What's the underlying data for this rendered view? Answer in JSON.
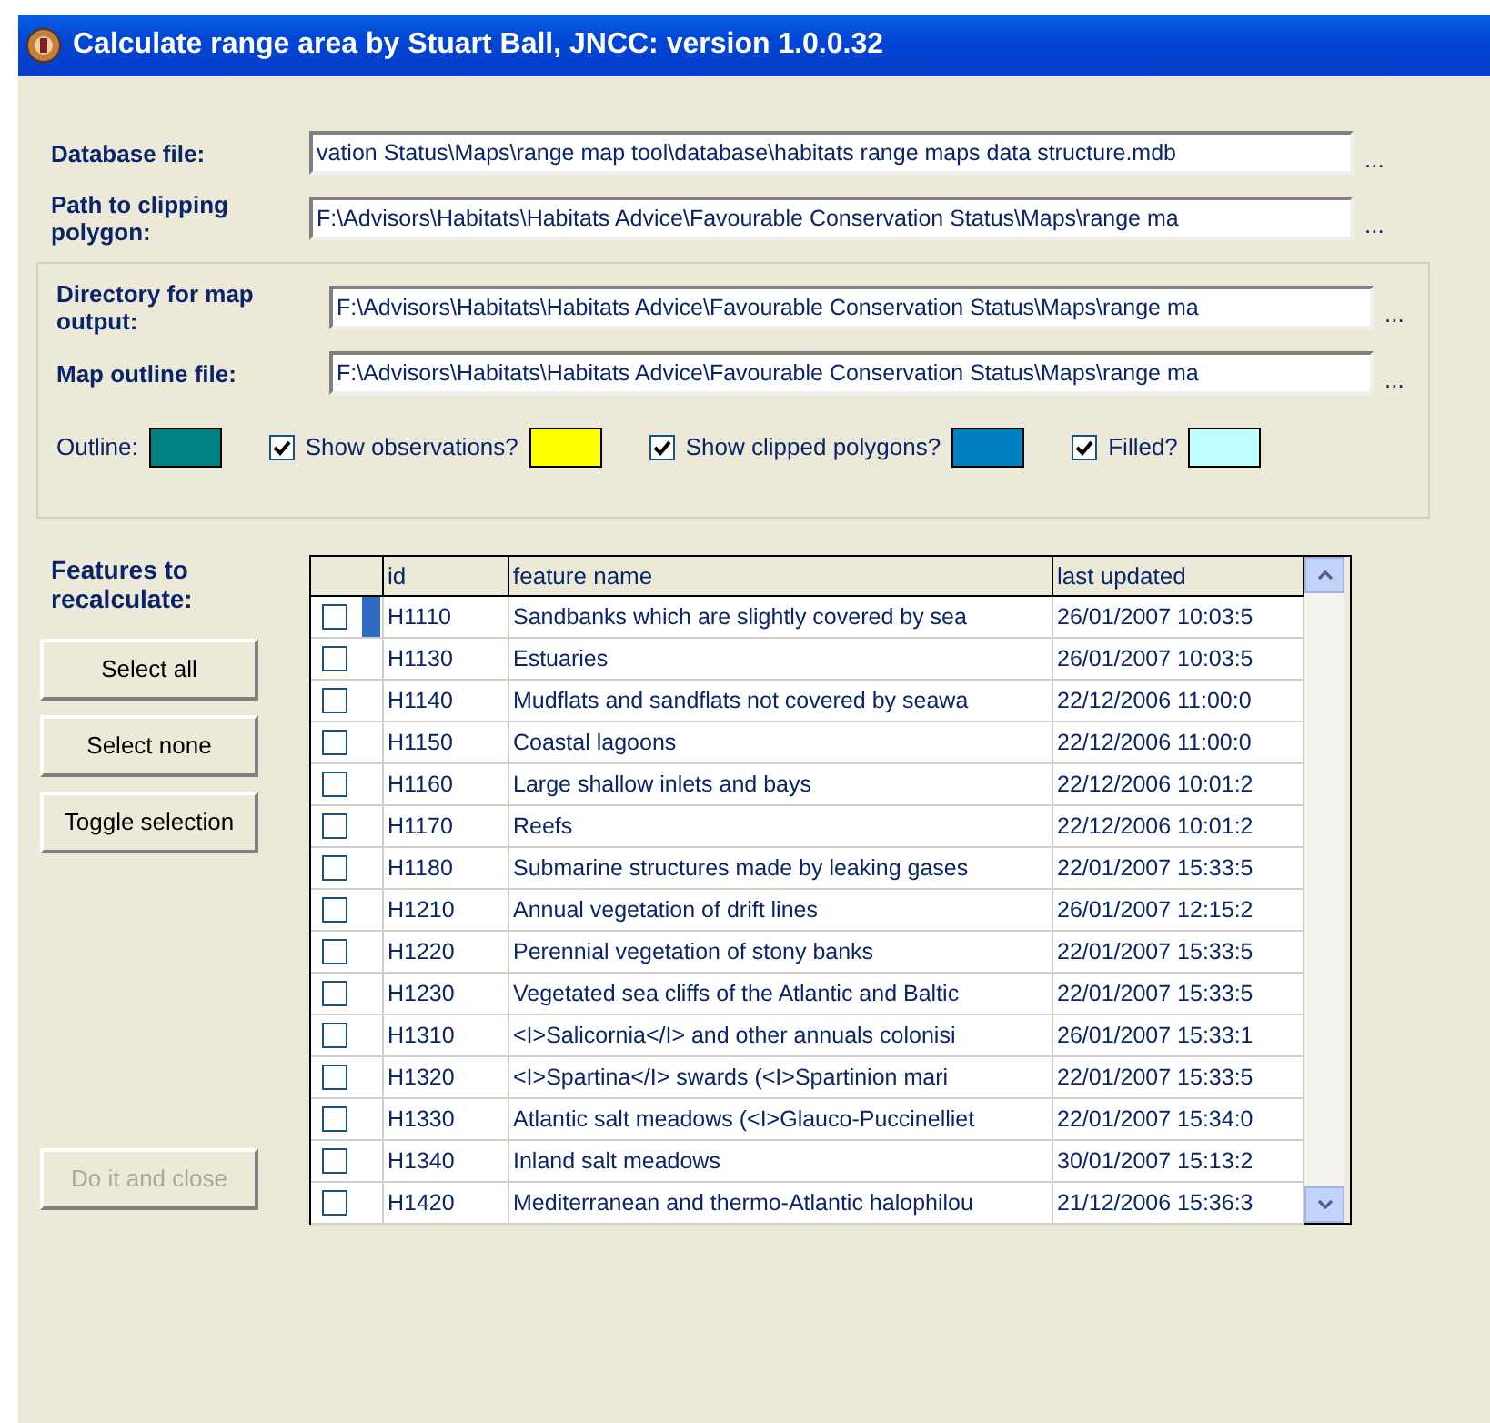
{
  "window": {
    "title": "Calculate range area by Stuart Ball, JNCC: version 1.0.0.32"
  },
  "paths": [
    {
      "label": "Database file:",
      "value": "vation Status\\Maps\\range map tool\\database\\habitats range maps data structure.mdb",
      "browse": "..."
    },
    {
      "label": "Path to clipping polygon:",
      "value": "F:\\Advisors\\Habitats\\Habitats Advice\\Favourable Conservation Status\\Maps\\range ma",
      "browse": "..."
    }
  ],
  "output_group": {
    "paths": [
      {
        "label": "Directory for map output:",
        "value": "F:\\Advisors\\Habitats\\Habitats Advice\\Favourable Conservation Status\\Maps\\range ma",
        "browse": "..."
      },
      {
        "label": "Map outline file:",
        "value": "F:\\Advisors\\Habitats\\Habitats Advice\\Favourable Conservation Status\\Maps\\range ma",
        "browse": "..."
      }
    ],
    "options": [
      {
        "kind": "label",
        "label": "Outline:",
        "color": "#008080"
      },
      {
        "kind": "checkbox",
        "label": "Show observations?",
        "checked": true,
        "color": "#ffff00"
      },
      {
        "kind": "checkbox",
        "label": "Show clipped polygons?",
        "checked": true,
        "color": "#0080c0"
      },
      {
        "kind": "checkbox",
        "label": "Filled?",
        "checked": true,
        "color": "#c0ffff"
      }
    ]
  },
  "features": {
    "heading": "Features to recalculate:",
    "buttons": [
      {
        "label": "Select all",
        "disabled": false
      },
      {
        "label": "Select none",
        "disabled": false
      },
      {
        "label": "Toggle selection",
        "disabled": false
      }
    ],
    "close_button": {
      "label": "Do it and close",
      "disabled": true
    }
  },
  "table": {
    "columns": [
      "id",
      "feature name",
      "last updated"
    ],
    "rows": [
      {
        "checked": false,
        "selected": true,
        "cells": [
          "H1110",
          "Sandbanks which are slightly covered by sea",
          "26/01/2007 10:03:5"
        ]
      },
      {
        "checked": false,
        "selected": false,
        "cells": [
          "H1130",
          "Estuaries",
          "26/01/2007 10:03:5"
        ]
      },
      {
        "checked": false,
        "selected": false,
        "cells": [
          "H1140",
          "Mudflats and sandflats not covered by seawa",
          "22/12/2006 11:00:0"
        ]
      },
      {
        "checked": false,
        "selected": false,
        "cells": [
          "H1150",
          "Coastal lagoons",
          "22/12/2006 11:00:0"
        ]
      },
      {
        "checked": false,
        "selected": false,
        "cells": [
          "H1160",
          "Large shallow inlets and bays",
          "22/12/2006 10:01:2"
        ]
      },
      {
        "checked": false,
        "selected": false,
        "cells": [
          "H1170",
          "Reefs",
          "22/12/2006 10:01:2"
        ]
      },
      {
        "checked": false,
        "selected": false,
        "cells": [
          "H1180",
          "Submarine structures made by leaking gases",
          "22/01/2007 15:33:5"
        ]
      },
      {
        "checked": false,
        "selected": false,
        "cells": [
          "H1210",
          "Annual vegetation of drift lines",
          "26/01/2007 12:15:2"
        ]
      },
      {
        "checked": false,
        "selected": false,
        "cells": [
          "H1220",
          "Perennial vegetation of stony banks",
          "22/01/2007 15:33:5"
        ]
      },
      {
        "checked": false,
        "selected": false,
        "cells": [
          "H1230",
          "Vegetated sea cliffs of the Atlantic and Baltic",
          "22/01/2007 15:33:5"
        ]
      },
      {
        "checked": false,
        "selected": false,
        "cells": [
          "H1310",
          "<I>Salicornia</I> and other annuals colonisi",
          "26/01/2007 15:33:1"
        ]
      },
      {
        "checked": false,
        "selected": false,
        "cells": [
          "H1320",
          "<I>Spartina</I> swards (<I>Spartinion mari",
          "22/01/2007 15:33:5"
        ]
      },
      {
        "checked": false,
        "selected": false,
        "cells": [
          "H1330",
          "Atlantic salt meadows (<I>Glauco-Puccinelliet",
          "22/01/2007 15:34:0"
        ]
      },
      {
        "checked": false,
        "selected": false,
        "cells": [
          "H1340",
          "Inland salt meadows",
          "30/01/2007 15:13:2"
        ]
      },
      {
        "checked": false,
        "selected": false,
        "cells": [
          "H1420",
          "Mediterranean and thermo-Atlantic halophilou",
          "21/12/2006 15:36:3"
        ]
      }
    ]
  }
}
